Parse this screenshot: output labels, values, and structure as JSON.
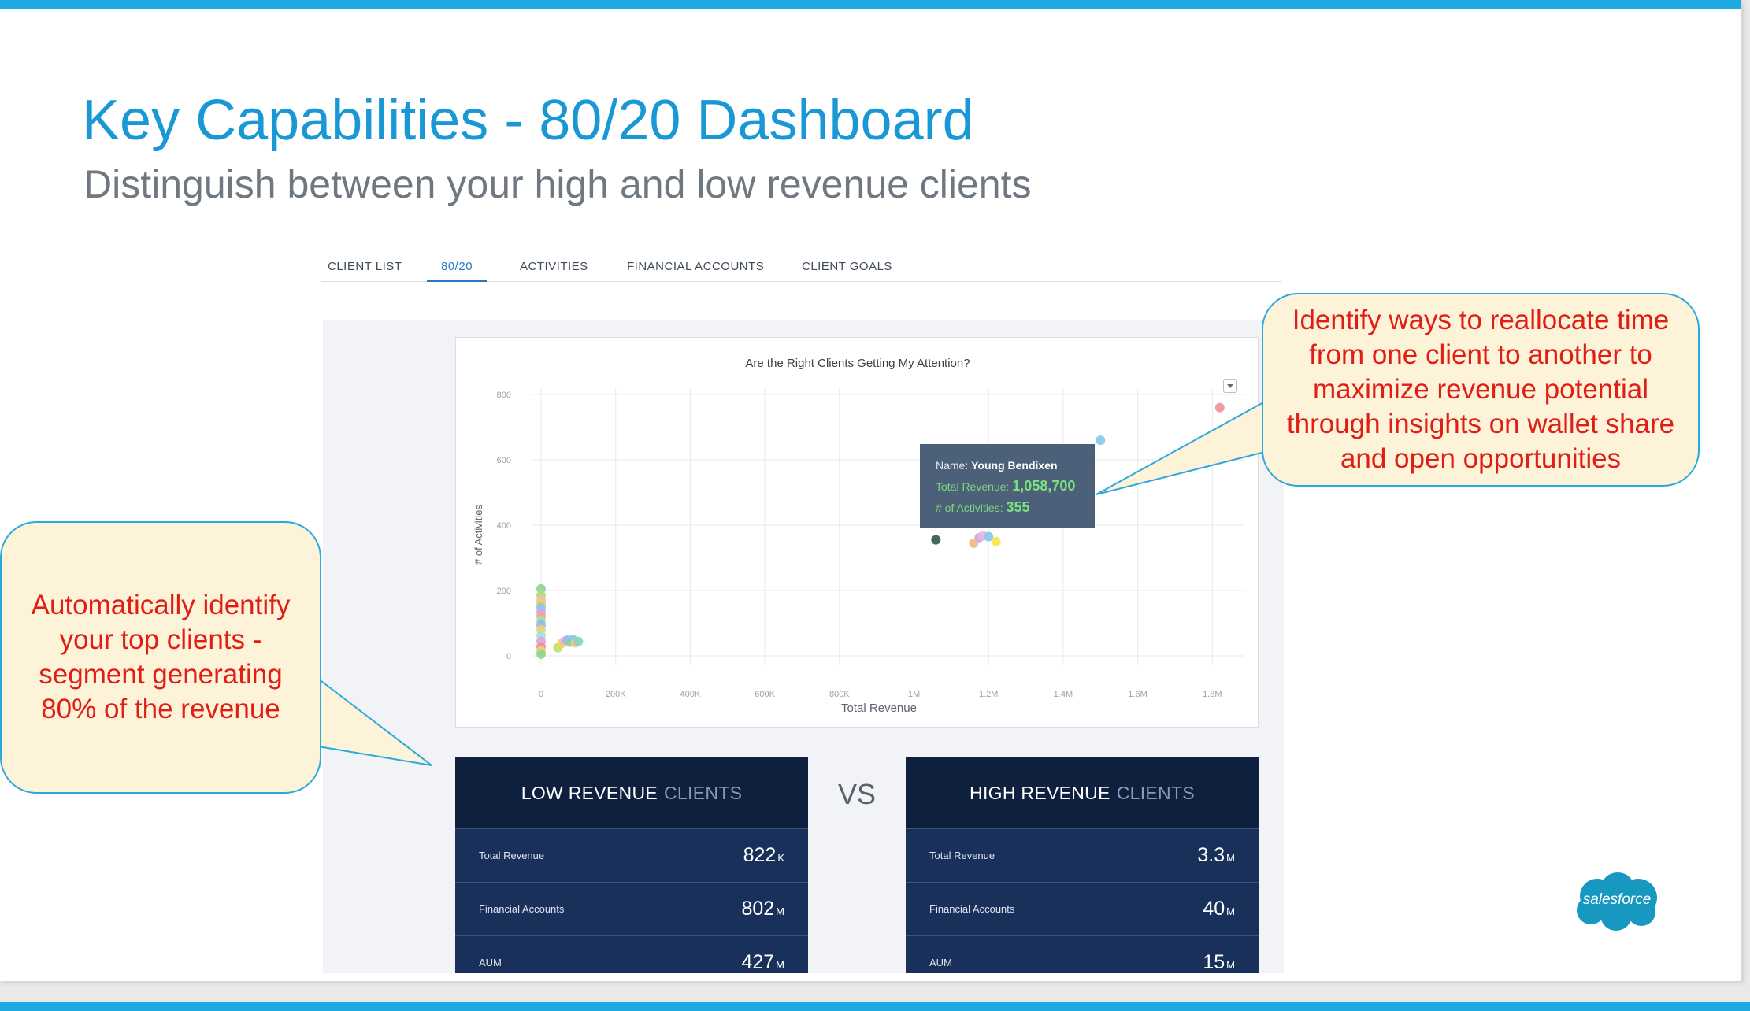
{
  "slide": {
    "title": "Key Capabilities - 80/20 Dashboard",
    "subtitle": "Distinguish between your high and low revenue clients"
  },
  "tabs": [
    {
      "label": "CLIENT LIST",
      "active": false
    },
    {
      "label": "80/20",
      "active": true
    },
    {
      "label": "ACTIVITIES",
      "active": false
    },
    {
      "label": "FINANCIAL ACCOUNTS",
      "active": false
    },
    {
      "label": "CLIENT GOALS",
      "active": false
    }
  ],
  "chart": {
    "title": "Are the Right Clients Getting My Attention?",
    "xlabel": "Total Revenue",
    "ylabel": "# of Activities"
  },
  "chart_data": {
    "type": "scatter",
    "title": "Are the Right Clients Getting My Attention?",
    "xlabel": "Total Revenue",
    "ylabel": "# of Activities",
    "xlim": [
      0,
      1850000
    ],
    "ylim": [
      0,
      800
    ],
    "x_ticks": [
      {
        "value": 0,
        "label": "0"
      },
      {
        "value": 200000,
        "label": "200K"
      },
      {
        "value": 400000,
        "label": "400K"
      },
      {
        "value": 600000,
        "label": "600K"
      },
      {
        "value": 800000,
        "label": "800K"
      },
      {
        "value": 1000000,
        "label": "1M"
      },
      {
        "value": 1200000,
        "label": "1.2M"
      },
      {
        "value": 1400000,
        "label": "1.4M"
      },
      {
        "value": 1600000,
        "label": "1.6M"
      },
      {
        "value": 1800000,
        "label": "1.8M"
      }
    ],
    "y_ticks": [
      {
        "value": 0,
        "label": "0"
      },
      {
        "value": 200,
        "label": "200"
      },
      {
        "value": 400,
        "label": "400"
      },
      {
        "value": 600,
        "label": "600"
      },
      {
        "value": 800,
        "label": "800"
      }
    ],
    "grid": true,
    "points": [
      {
        "x": 0,
        "y": 205,
        "color": "#8fd48f"
      },
      {
        "x": 0,
        "y": 185,
        "color": "#b9d86e"
      },
      {
        "x": 0,
        "y": 170,
        "color": "#f0b7d8"
      },
      {
        "x": 0,
        "y": 160,
        "color": "#f7d24b"
      },
      {
        "x": 0,
        "y": 148,
        "color": "#84c8ee"
      },
      {
        "x": 0,
        "y": 135,
        "color": "#c6a8ee"
      },
      {
        "x": 0,
        "y": 122,
        "color": "#f5a58f"
      },
      {
        "x": 0,
        "y": 108,
        "color": "#a7e0a5"
      },
      {
        "x": 0,
        "y": 95,
        "color": "#8fb8f0"
      },
      {
        "x": 0,
        "y": 80,
        "color": "#f3cf6c"
      },
      {
        "x": 0,
        "y": 62,
        "color": "#9ee6d1"
      },
      {
        "x": 0,
        "y": 45,
        "color": "#d7a6e0"
      },
      {
        "x": 0,
        "y": 28,
        "color": "#f08f8f"
      },
      {
        "x": 0,
        "y": 15,
        "color": "#e8d07a"
      },
      {
        "x": 0,
        "y": 5,
        "color": "#8fd48f"
      },
      {
        "x": 45000,
        "y": 25,
        "color": "#b9e36b"
      },
      {
        "x": 55000,
        "y": 38,
        "color": "#f7d24b"
      },
      {
        "x": 62000,
        "y": 45,
        "color": "#f0b7d8"
      },
      {
        "x": 70000,
        "y": 48,
        "color": "#9ab7ee"
      },
      {
        "x": 78000,
        "y": 42,
        "color": "#8fd48f"
      },
      {
        "x": 85000,
        "y": 50,
        "color": "#84c8ee"
      },
      {
        "x": 92000,
        "y": 40,
        "color": "#f5c57d"
      },
      {
        "x": 100000,
        "y": 44,
        "color": "#7fd6c8"
      },
      {
        "x": 1058700,
        "y": 355,
        "color": "#2e5a45"
      },
      {
        "x": 1160000,
        "y": 345,
        "color": "#f3b77d"
      },
      {
        "x": 1175000,
        "y": 362,
        "color": "#c6a8ee"
      },
      {
        "x": 1185000,
        "y": 368,
        "color": "#f0b7d8"
      },
      {
        "x": 1200000,
        "y": 365,
        "color": "#84c8ee"
      },
      {
        "x": 1220000,
        "y": 350,
        "color": "#f7e34b"
      },
      {
        "x": 1500000,
        "y": 660,
        "color": "#84c8ee"
      },
      {
        "x": 1820000,
        "y": 760,
        "color": "#f08f98"
      }
    ],
    "tooltip": {
      "name_key": "Name:",
      "name": "Young Bendixen",
      "revenue_key": "Total Revenue:",
      "revenue": "1,058,700",
      "activities_key": "# of Activities:",
      "activities": "355"
    }
  },
  "callouts": {
    "left": "Automatically identify your top clients - segment generating 80% of the revenue",
    "right": "Identify ways to reallocate time from one client to another to maximize revenue potential through insights on wallet share and open opportunities",
    "colors": {
      "fill": "#fdf3d9",
      "border": "#2aa9dd",
      "text": "#e11e16"
    }
  },
  "low_revenue": {
    "title": "LOW REVENUE",
    "title_suffix": "CLIENTS",
    "rows": [
      {
        "label": "Total Revenue",
        "value": "822",
        "unit": "K"
      },
      {
        "label": "Financial Accounts",
        "value": "802",
        "unit": "M"
      },
      {
        "label": "AUM",
        "value": "427",
        "unit": "M"
      }
    ]
  },
  "vs_label": "VS",
  "high_revenue": {
    "title": "HIGH REVENUE",
    "title_suffix": "CLIENTS",
    "rows": [
      {
        "label": "Total Revenue",
        "value": "3.3",
        "unit": "M"
      },
      {
        "label": "Financial Accounts",
        "value": "40",
        "unit": "M"
      },
      {
        "label": "AUM",
        "value": "15",
        "unit": "M"
      }
    ]
  },
  "logo": {
    "text": "salesforce",
    "icon": "salesforce-cloud-logo",
    "color": "#1798c1"
  },
  "colors": {
    "brand_blue": "#1fa9e1",
    "title_blue": "#1a98d5",
    "navy": "#19305a"
  }
}
